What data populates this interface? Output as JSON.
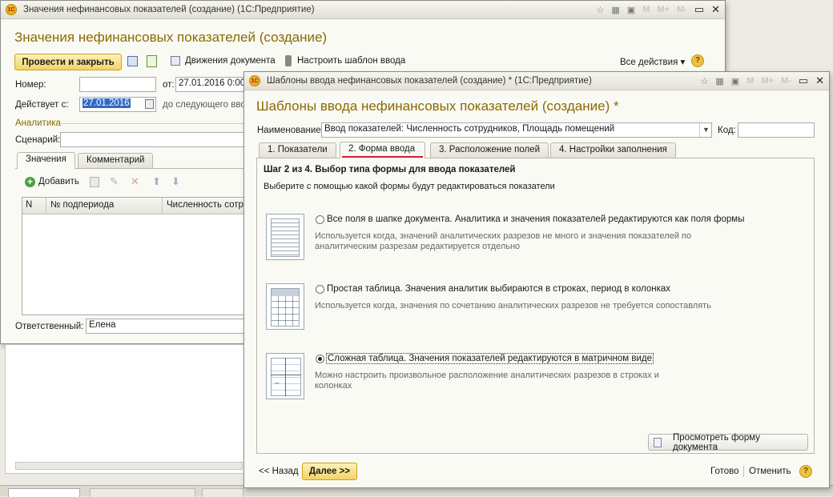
{
  "back_window": {
    "title": "Значения нефинансовых показателей (создание)  (1С:Предприятие)",
    "heading": "Значения нефинансовых показателей (создание)",
    "toolbar": {
      "post_close": "Провести и закрыть",
      "movements": "Движения документа",
      "setup_template": "Настроить шаблон ввода",
      "all_actions": "Все действия ▾"
    },
    "number_label": "Номер:",
    "number_value": "",
    "from_label": "от:",
    "from_value": "27.01.2016 0:00",
    "valid_label": "Действует с:",
    "valid_value": "27.01.2016",
    "until_label": "до следующего вво",
    "analytics_label": "Аналитика",
    "scenario_label": "Сценарий:",
    "scenario_value": "",
    "tabs": [
      "Значения",
      "Комментарий"
    ],
    "add_label": "Добавить",
    "columns": [
      "N",
      "№ подпериода",
      "Численность сотру"
    ],
    "responsible_label": "Ответственный:",
    "responsible_value": "Елена"
  },
  "front_window": {
    "title": "Шаблоны ввода нефинансовых показателей (создание) *  (1С:Предприятие)",
    "heading": "Шаблоны ввода нефинансовых показателей (создание) *",
    "name_label": "Наименование:",
    "name_value": "Ввод показателей: Численность сотрудников, Площадь помещений",
    "code_label": "Код:",
    "code_value": "",
    "tabs": [
      "1. Показатели",
      "2. Форма ввода",
      "3. Расположение полей",
      "4. Настройки заполнения"
    ],
    "active_tab": 1,
    "step_title": "Шаг 2 из 4. Выбор типа формы для ввода показателей",
    "step_desc": "Выберите с помощью какой формы будут редактироваться показатели",
    "options": [
      {
        "label": "Все поля в шапке документа. Аналитика и значения показателей редактируются как поля формы",
        "desc": "Используется когда, значений аналитических разрезов не много и значения показателей по аналитическим разрезам редактируется отдельно",
        "selected": false
      },
      {
        "label": "Простая таблица. Значения аналитик выбираются в строках, период в колонках",
        "desc": "Используется когда, значения по сочетанию аналитических разрезов не требуется сопоставлять",
        "selected": false
      },
      {
        "label": "Сложная таблица. Значения показателей редактируются в матричном виде",
        "desc": "Можно настроить произвольное расположение аналитических разрезов в строках и колонках",
        "selected": true
      }
    ],
    "preview_button": "Просмотреть форму документа",
    "back_button": "<< Назад",
    "next_button": "Далее >>",
    "done_button": "Готово",
    "cancel_button": "Отменить"
  },
  "title_icons": [
    "M",
    "M+",
    "M-"
  ],
  "colors": {
    "accent": "#8a6a00",
    "button_yellow": "#f2d468",
    "tab_underline": "#d0202a"
  }
}
